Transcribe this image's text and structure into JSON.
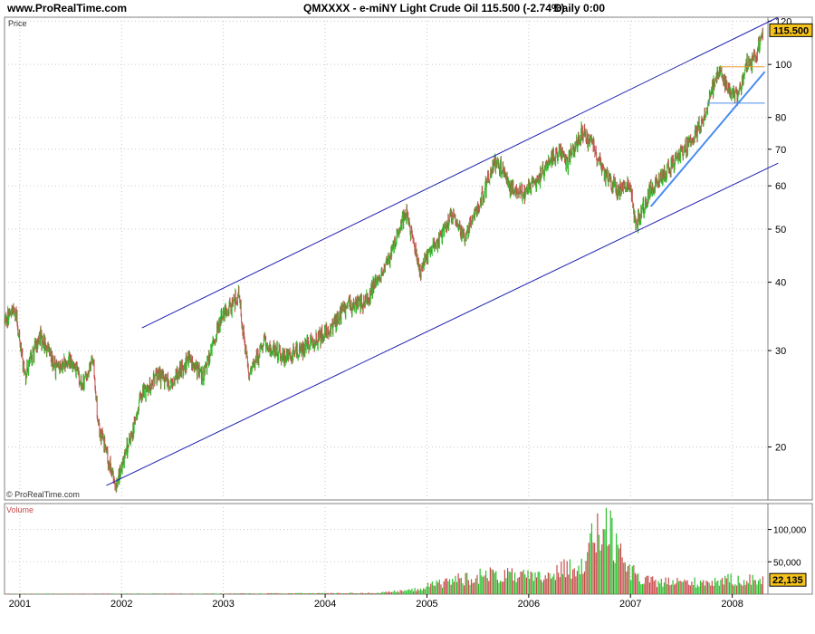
{
  "header": {
    "site": "www.ProRealTime.com",
    "title": "QMXXXX - e-miNY Light Crude Oil   115.500 (-2.74%)",
    "timeframe": "Daily  0:00"
  },
  "colors": {
    "up": "#2bbf2b",
    "down": "#c84a4a",
    "channel": "#2020b0",
    "trend": "#4a8cf0",
    "resistance": "#e89a30",
    "grid": "#c8c8c8",
    "price_badge": "#f5c21b"
  },
  "chart_data": [
    {
      "type": "candlestick",
      "panel_label": "Price",
      "copyright": "© ProRealTime.com",
      "scale": "log",
      "ylim": [
        16,
        122
      ],
      "xlim": [
        2000.85,
        2008.35
      ],
      "y_ticks": [
        20,
        30,
        40,
        50,
        60,
        70,
        80,
        100,
        120
      ],
      "y_tick_labels": [
        "20",
        "30",
        "40",
        "50",
        "60",
        "70",
        "80",
        "100",
        "120"
      ],
      "last_price": "115.500",
      "anchors": [
        [
          2000.85,
          34
        ],
        [
          2000.95,
          36
        ],
        [
          2001.05,
          27
        ],
        [
          2001.2,
          32
        ],
        [
          2001.35,
          28
        ],
        [
          2001.5,
          29
        ],
        [
          2001.62,
          26
        ],
        [
          2001.72,
          29
        ],
        [
          2001.77,
          22
        ],
        [
          2001.87,
          19
        ],
        [
          2001.94,
          17
        ],
        [
          2002.1,
          21
        ],
        [
          2002.2,
          25
        ],
        [
          2002.35,
          27
        ],
        [
          2002.5,
          26
        ],
        [
          2002.65,
          29
        ],
        [
          2002.8,
          27
        ],
        [
          2002.97,
          34
        ],
        [
          2003.15,
          38
        ],
        [
          2003.25,
          27
        ],
        [
          2003.4,
          31
        ],
        [
          2003.6,
          29
        ],
        [
          2003.72,
          30
        ],
        [
          2003.9,
          31
        ],
        [
          2004.05,
          33
        ],
        [
          2004.2,
          36
        ],
        [
          2004.4,
          37
        ],
        [
          2004.6,
          43
        ],
        [
          2004.8,
          54
        ],
        [
          2004.93,
          42
        ],
        [
          2005.05,
          46
        ],
        [
          2005.25,
          53
        ],
        [
          2005.38,
          48
        ],
        [
          2005.55,
          58
        ],
        [
          2005.68,
          67
        ],
        [
          2005.82,
          60
        ],
        [
          2005.95,
          58
        ],
        [
          2006.1,
          62
        ],
        [
          2006.3,
          70
        ],
        [
          2006.38,
          66
        ],
        [
          2006.52,
          75
        ],
        [
          2006.62,
          72
        ],
        [
          2006.75,
          63
        ],
        [
          2006.87,
          59
        ],
        [
          2007.0,
          60
        ],
        [
          2007.05,
          51
        ],
        [
          2007.2,
          59
        ],
        [
          2007.4,
          65
        ],
        [
          2007.55,
          71
        ],
        [
          2007.7,
          78
        ],
        [
          2007.82,
          92
        ],
        [
          2007.88,
          98
        ],
        [
          2007.95,
          90
        ],
        [
          2008.05,
          88
        ],
        [
          2008.15,
          100
        ],
        [
          2008.23,
          103
        ],
        [
          2008.3,
          115.5
        ]
      ],
      "lines": [
        {
          "name": "upper-channel",
          "from": [
            2002.2,
            33
          ],
          "to": [
            2008.45,
            122
          ],
          "color": "#2020b0"
        },
        {
          "name": "lower-channel",
          "from": [
            2001.85,
            17
          ],
          "to": [
            2008.45,
            66
          ],
          "color": "#2020b0"
        },
        {
          "name": "trend-line",
          "from": [
            2007.2,
            55
          ],
          "to": [
            2008.32,
            97
          ],
          "color": "#4a8cf0"
        },
        {
          "name": "support-line",
          "from": [
            2007.75,
            85
          ],
          "to": [
            2008.32,
            85
          ],
          "color": "#4a8cf0"
        },
        {
          "name": "resistance-line",
          "from": [
            2007.88,
            99
          ],
          "to": [
            2008.32,
            99
          ],
          "color": "#e89a30"
        }
      ]
    },
    {
      "type": "bar",
      "panel_label": "Volume",
      "ylim": [
        0,
        140000
      ],
      "y_ticks": [
        50000,
        100000
      ],
      "y_tick_labels": [
        "50,000",
        "100,000"
      ],
      "last_value": "22,135",
      "profile": [
        [
          2000.85,
          600
        ],
        [
          2003.0,
          900
        ],
        [
          2004.5,
          1800
        ],
        [
          2004.85,
          6000
        ],
        [
          2005.2,
          20000
        ],
        [
          2005.6,
          30000
        ],
        [
          2006.1,
          25000
        ],
        [
          2006.5,
          45000
        ],
        [
          2006.75,
          110000
        ],
        [
          2006.9,
          55000
        ],
        [
          2007.1,
          20000
        ],
        [
          2007.6,
          18000
        ],
        [
          2008.0,
          22000
        ],
        [
          2008.3,
          22135
        ]
      ]
    }
  ],
  "x_axis": {
    "ticks": [
      2001,
      2002,
      2003,
      2004,
      2005,
      2006,
      2007,
      2008
    ],
    "labels": [
      "2001",
      "2002",
      "2003",
      "2004",
      "2005",
      "2006",
      "2007",
      "2008"
    ]
  }
}
